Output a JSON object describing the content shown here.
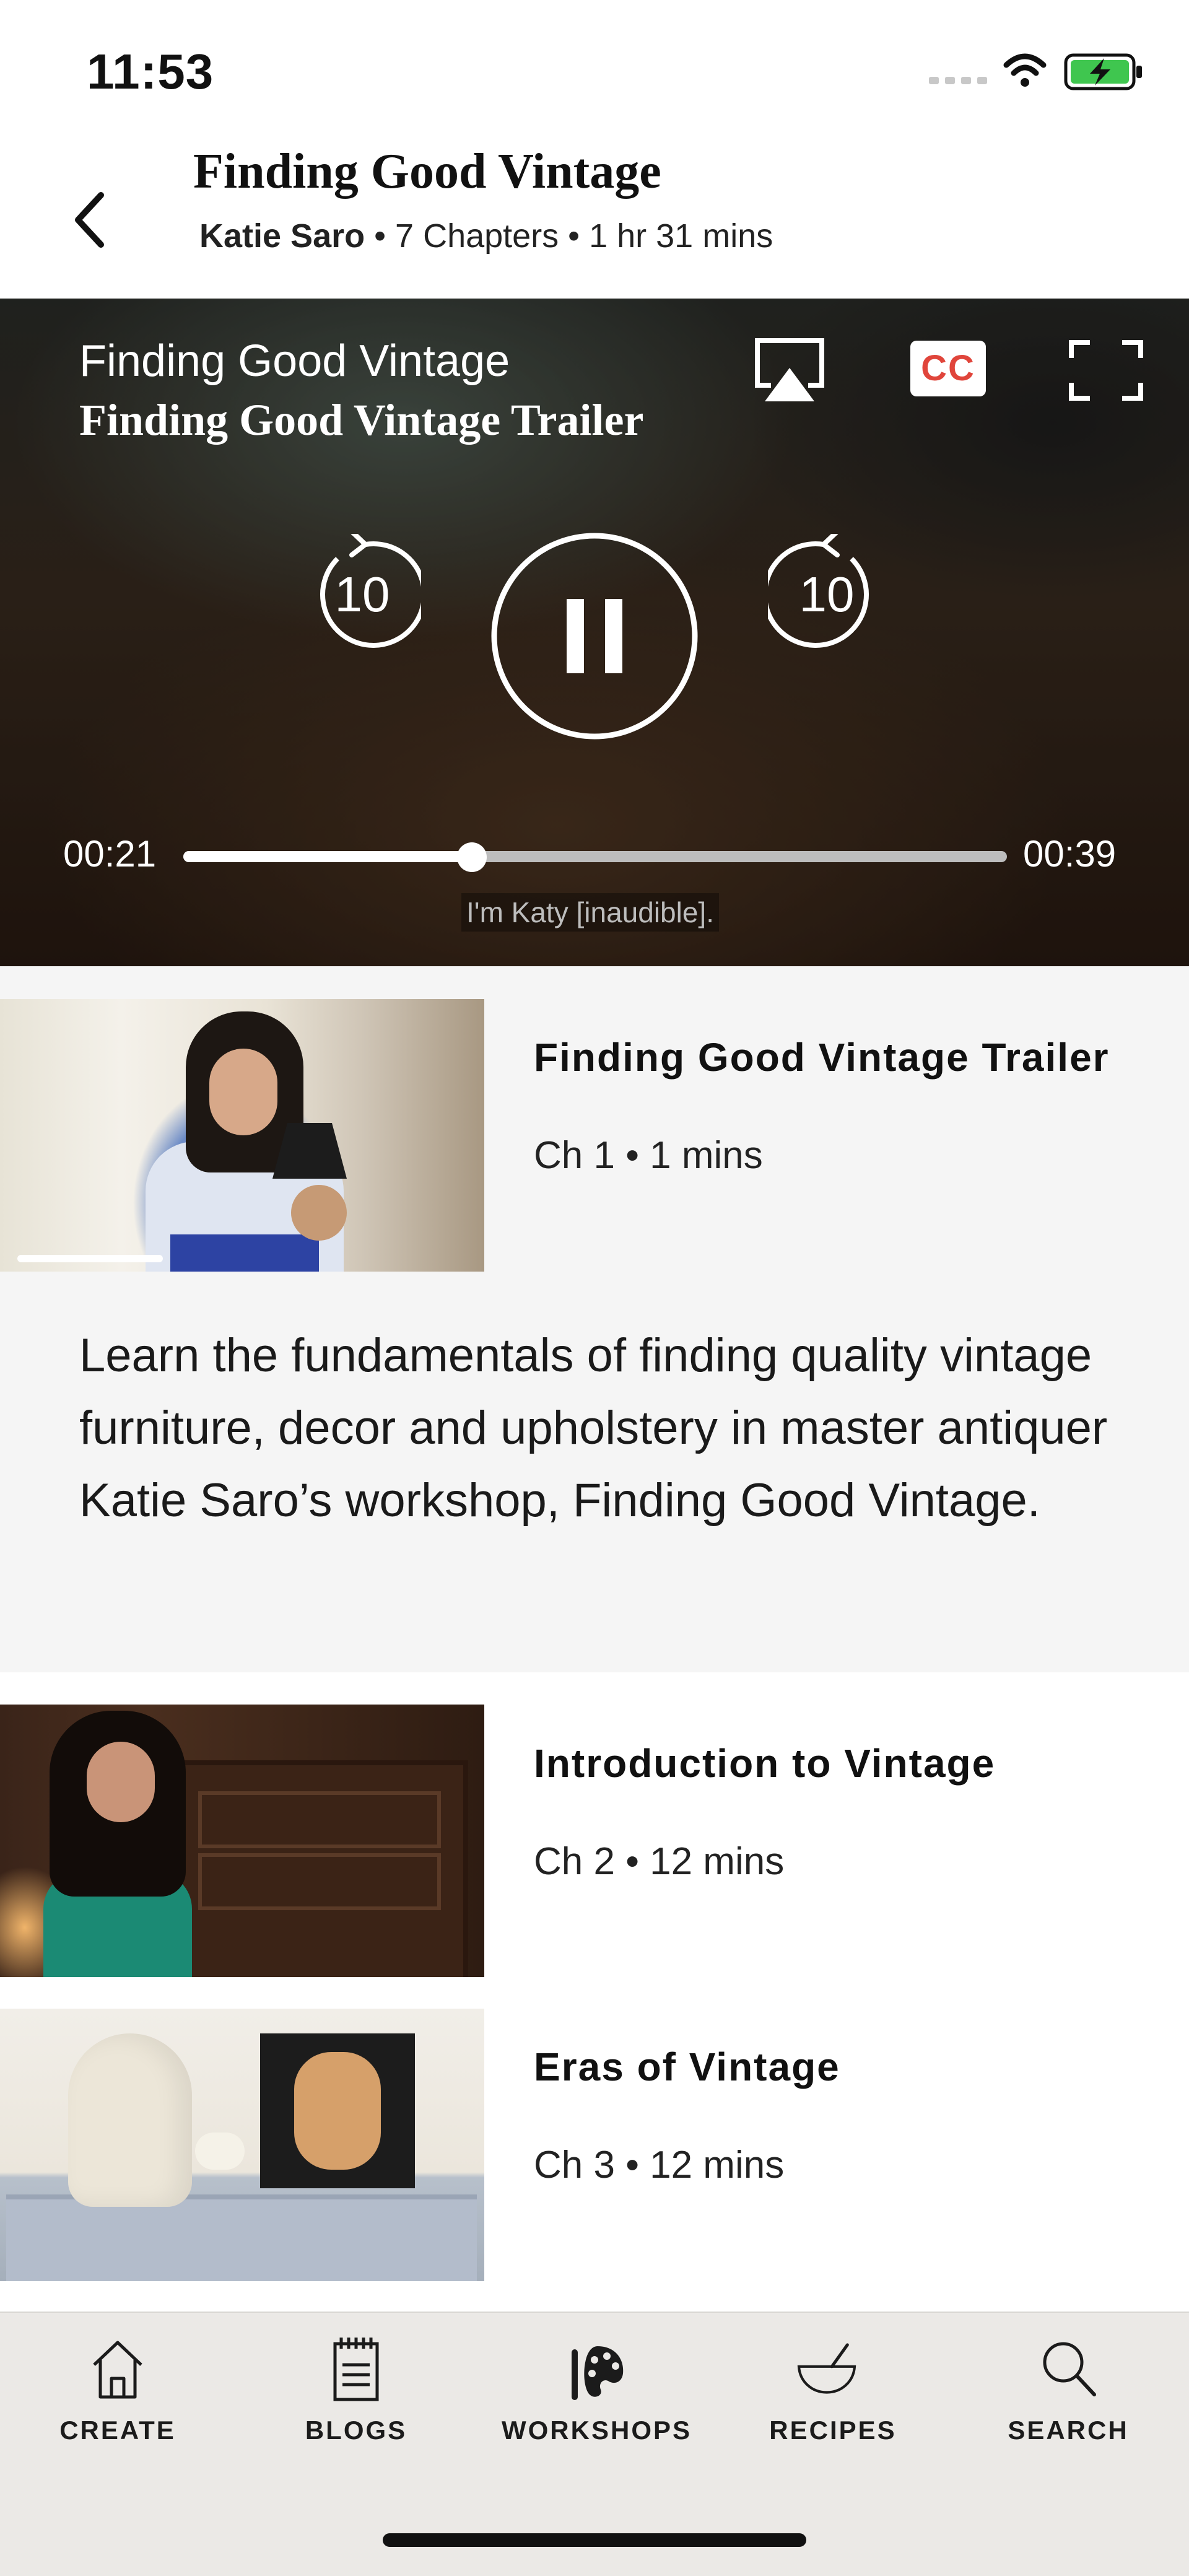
{
  "status_bar": {
    "time": "11:53"
  },
  "header": {
    "title": "Finding Good Vintage",
    "author": "Katie Saro",
    "meta": "• 7 Chapters • 1 hr 31 mins"
  },
  "player": {
    "course_title": "Finding Good Vintage",
    "chapter_title": "Finding Good Vintage Trailer",
    "cc_label": "CC",
    "skip_back": "10",
    "skip_forward": "10",
    "current_time": "00:21",
    "duration": "00:39",
    "progress_fraction": 0.35,
    "caption": "I'm Katy [inaudible]."
  },
  "chapters": [
    {
      "title": "Finding Good Vintage Trailer",
      "meta": "Ch 1 • 1 mins",
      "watched_fraction": 0.3
    },
    {
      "title": "Introduction to Vintage",
      "meta": "Ch 2 • 12 mins"
    },
    {
      "title": "Eras of Vintage",
      "meta": "Ch 3 • 12 mins"
    }
  ],
  "description": "Learn the fundamentals of finding quality vintage furniture, decor and upholstery in master antiquer Katie Saro’s workshop, Finding Good Vintage.",
  "tabs": [
    {
      "label": "CREATE",
      "icon": "house-icon"
    },
    {
      "label": "BLOGS",
      "icon": "notepad-icon"
    },
    {
      "label": "WORKSHOPS",
      "icon": "palette-icon"
    },
    {
      "label": "RECIPES",
      "icon": "bowl-icon"
    },
    {
      "label": "SEARCH",
      "icon": "search-icon"
    }
  ],
  "colors": {
    "cc_text": "#e0453b",
    "battery": "#3fc64f",
    "section_bg": "#f5f5f5",
    "tabbar_bg": "#ebe9e6"
  }
}
